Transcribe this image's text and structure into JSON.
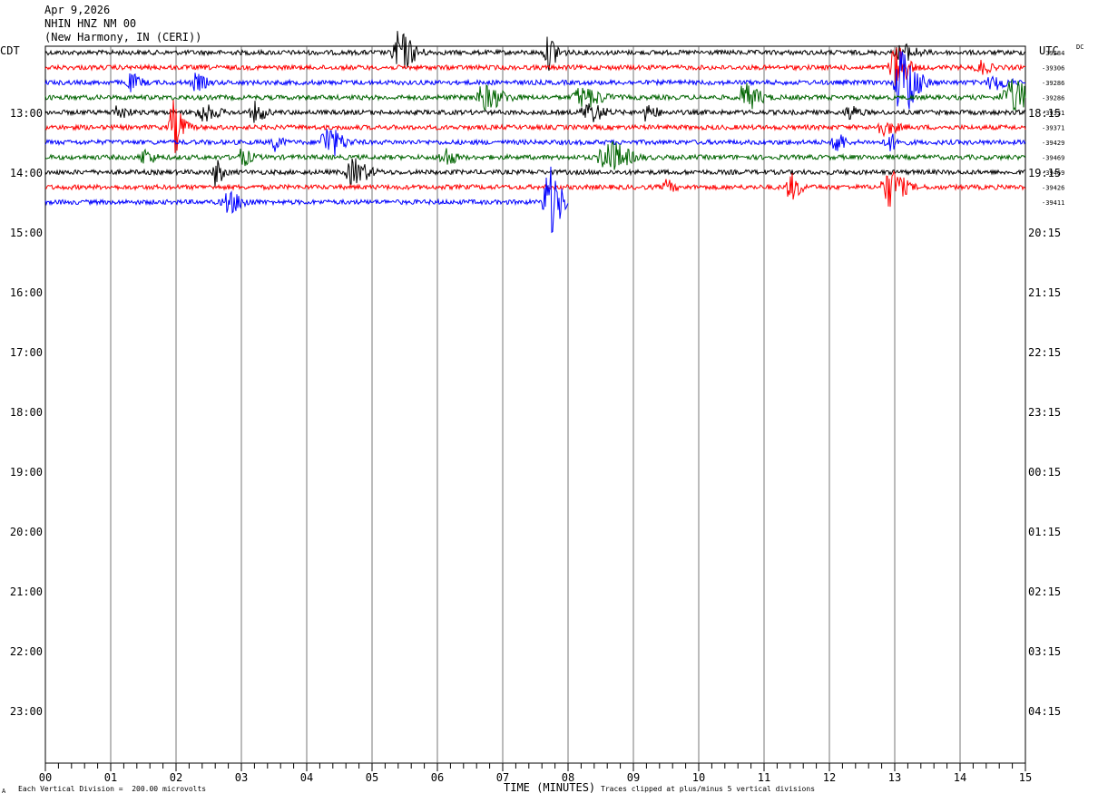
{
  "header": {
    "date": "Apr 9,2026",
    "station": "NHIN HNZ NM 00",
    "location": "(New Harmony, IN (CERI))"
  },
  "left_tz": "CDT",
  "right_tz": "UTC",
  "dc_label": "DC",
  "footer": {
    "mark": "A",
    "scale": "Each Vertical Division =  200.00 microvolts",
    "xlabel": "TIME (MINUTES)",
    "clip_note": "Traces clipped at plus/minus 5 vertical divisions"
  },
  "colors": [
    "#000000",
    "#ff0000",
    "#0000ff",
    "#006400"
  ],
  "chart_data": {
    "type": "line",
    "xlabel": "TIME (MINUTES)",
    "xlim": [
      0,
      15
    ],
    "x_ticks": [
      "00",
      "01",
      "02",
      "03",
      "04",
      "05",
      "06",
      "07",
      "08",
      "09",
      "10",
      "11",
      "12",
      "13",
      "14",
      "15"
    ],
    "left_labels": [
      "13:00",
      "14:00",
      "15:00",
      "16:00",
      "17:00",
      "18:00",
      "19:00",
      "20:00",
      "21:00",
      "22:00",
      "23:00"
    ],
    "right_labels": [
      "18:15",
      "19:15",
      "20:15",
      "21:15",
      "22:15",
      "23:15",
      "00:15",
      "01:15",
      "02:15",
      "03:15",
      "04:15"
    ],
    "rows": [
      {
        "dc": "-39284",
        "color": "#000000",
        "end_min": 15,
        "events": [
          [
            5.4,
            3.2,
            0.3
          ],
          [
            7.7,
            2.5,
            0.2
          ],
          [
            13.1,
            1.2,
            0.3
          ]
        ]
      },
      {
        "dc": "-39306",
        "color": "#ff0000",
        "end_min": 15,
        "events": [
          [
            13.0,
            3.5,
            0.25
          ],
          [
            14.3,
            1.0,
            0.2
          ]
        ]
      },
      {
        "dc": "-39286",
        "color": "#0000ff",
        "end_min": 15,
        "events": [
          [
            1.3,
            1.2,
            0.2
          ],
          [
            2.3,
            1.2,
            0.2
          ],
          [
            13.1,
            6.0,
            0.3
          ],
          [
            14.5,
            1.0,
            0.3
          ]
        ]
      },
      {
        "dc": "-39286",
        "color": "#006400",
        "end_min": 15,
        "events": [
          [
            6.7,
            1.8,
            0.4
          ],
          [
            8.2,
            1.5,
            0.4
          ],
          [
            10.7,
            2.0,
            0.3
          ],
          [
            14.8,
            2.5,
            0.5
          ]
        ]
      },
      {
        "dc": "-39331",
        "color": "#000000",
        "end_min": 15,
        "events": [
          [
            1.1,
            1.0,
            0.2
          ],
          [
            2.4,
            1.2,
            0.3
          ],
          [
            3.2,
            1.5,
            0.2
          ],
          [
            8.3,
            1.5,
            0.3
          ],
          [
            9.2,
            1.2,
            0.2
          ],
          [
            12.3,
            1.0,
            0.2
          ]
        ]
      },
      {
        "dc": "-39371",
        "color": "#ff0000",
        "end_min": 15,
        "events": [
          [
            1.95,
            4.0,
            0.2
          ],
          [
            12.8,
            1.0,
            0.3
          ]
        ]
      },
      {
        "dc": "-39429",
        "color": "#0000ff",
        "end_min": 15,
        "events": [
          [
            3.5,
            1.2,
            0.15
          ],
          [
            4.3,
            2.5,
            0.3
          ],
          [
            12.1,
            2.0,
            0.15
          ],
          [
            12.9,
            1.2,
            0.2
          ]
        ]
      },
      {
        "dc": "-39469",
        "color": "#006400",
        "end_min": 15,
        "events": [
          [
            1.5,
            1.2,
            0.2
          ],
          [
            3.0,
            1.2,
            0.2
          ],
          [
            6.1,
            1.5,
            0.2
          ],
          [
            8.6,
            2.5,
            0.4
          ]
        ]
      },
      {
        "dc": "-39469",
        "color": "#000000",
        "end_min": 15,
        "events": [
          [
            2.6,
            2.0,
            0.15
          ],
          [
            4.7,
            2.0,
            0.3
          ]
        ]
      },
      {
        "dc": "-39426",
        "color": "#ff0000",
        "end_min": 15,
        "events": [
          [
            9.5,
            1.0,
            0.15
          ],
          [
            11.4,
            2.0,
            0.2
          ],
          [
            12.9,
            3.0,
            0.3
          ]
        ]
      },
      {
        "dc": "-39411",
        "color": "#0000ff",
        "end_min": 8,
        "events": [
          [
            2.8,
            1.5,
            0.3
          ],
          [
            7.7,
            5.5,
            0.25
          ]
        ]
      }
    ]
  }
}
